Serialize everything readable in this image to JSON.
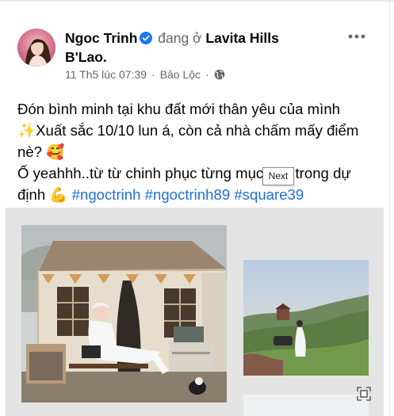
{
  "post": {
    "author": "Ngoc Trinh",
    "at_label": "đang ở",
    "location": "Lavita Hills B'Lao.",
    "time": "11 Th5 lúc 07:39",
    "separator": "·",
    "place": "Bảo Lộc",
    "separator2": "·",
    "line1": "Đón bình minh tại khu đất mới thân yêu của mình",
    "line2": "✨Xuất sắc 10/10 lun á, còn cả nhà chấm mấy điểm nè? 🥰",
    "line3_pre": "Ố yeahhh..từ từ chinh phục từng mục tiêu trong dự định 💪 ",
    "hashtags": [
      "#ngoctrinh",
      "#ngoctrinh89",
      "#square39"
    ]
  },
  "tooltip": {
    "text": "Next"
  },
  "icons": {
    "verified": "verified-badge-icon",
    "globe": "globe-icon",
    "more": "more-options-icon",
    "expand": "fullscreen-icon"
  },
  "colors": {
    "link": "#216fdb",
    "muted": "#65676b",
    "verified": "#1877f2"
  }
}
